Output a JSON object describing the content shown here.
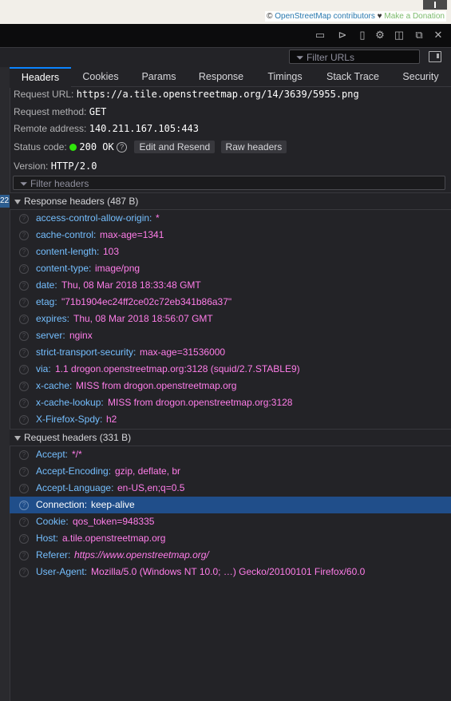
{
  "map": {
    "attribution_prefix": "©",
    "osm_link": "OpenStreetMap contributors",
    "heart": "♥",
    "donate": "Make a Donation"
  },
  "toolbar": {
    "icons": [
      "dock-layout-icon",
      "console-icon",
      "responsive-icon",
      "settings-icon",
      "split-icon",
      "undock-icon",
      "close-icon"
    ]
  },
  "filter_urls": {
    "placeholder": "Filter URLs"
  },
  "gutter": {
    "mark": "22"
  },
  "tabs": [
    "Headers",
    "Cookies",
    "Params",
    "Response",
    "Timings",
    "Stack Trace",
    "Security"
  ],
  "active_tab": "Headers",
  "summary": {
    "request_url_label": "Request URL:",
    "request_url": "https://a.tile.openstreetmap.org/14/3639/5955.png",
    "method_label": "Request method:",
    "method": "GET",
    "remote_label": "Remote address:",
    "remote": "140.211.167.105:443",
    "status_label": "Status code:",
    "status": "200 OK",
    "status_color": "#30e60b",
    "edit_resend": "Edit and Resend",
    "raw_headers": "Raw headers",
    "version_label": "Version:",
    "version": "HTTP/2.0"
  },
  "filter_headers": {
    "placeholder": "Filter headers"
  },
  "response_headers": {
    "title": "Response headers (487 B)",
    "rows": [
      {
        "k": "access-control-allow-origin:",
        "v": "*"
      },
      {
        "k": "cache-control:",
        "v": "max-age=1341"
      },
      {
        "k": "content-length:",
        "v": "103"
      },
      {
        "k": "content-type:",
        "v": "image/png"
      },
      {
        "k": "date:",
        "v": "Thu, 08 Mar 2018 18:33:48 GMT"
      },
      {
        "k": "etag:",
        "v": "\"71b1904ec24ff2ce02c72eb341b86a37\""
      },
      {
        "k": "expires:",
        "v": "Thu, 08 Mar 2018 18:56:07 GMT"
      },
      {
        "k": "server:",
        "v": "nginx"
      },
      {
        "k": "strict-transport-security:",
        "v": "max-age=31536000"
      },
      {
        "k": "via:",
        "v": "1.1 drogon.openstreetmap.org:3128 (squid/2.7.STABLE9)"
      },
      {
        "k": "x-cache:",
        "v": "MISS from drogon.openstreetmap.org"
      },
      {
        "k": "x-cache-lookup:",
        "v": "MISS from drogon.openstreetmap.org:3128"
      },
      {
        "k": "X-Firefox-Spdy:",
        "v": "h2"
      }
    ]
  },
  "request_headers": {
    "title": "Request headers (331 B)",
    "rows": [
      {
        "k": "Accept:",
        "v": "*/*"
      },
      {
        "k": "Accept-Encoding:",
        "v": "gzip, deflate, br"
      },
      {
        "k": "Accept-Language:",
        "v": "en-US,en;q=0.5"
      },
      {
        "k": "Connection:",
        "v": "keep-alive"
      },
      {
        "k": "Cookie:",
        "v": "qos_token=948335"
      },
      {
        "k": "Host:",
        "v": "a.tile.openstreetmap.org"
      },
      {
        "k": "Referer:",
        "v": "https://www.openstreetmap.org/"
      },
      {
        "k": "User-Agent:",
        "v": "Mozilla/5.0 (Windows NT 10.0; …) Gecko/20100101 Firefox/60.0"
      }
    ],
    "selected": "Connection:"
  },
  "colors": {
    "accent": "#0a84ff",
    "header_name": "#75bfff",
    "header_value": "#ff7de9",
    "selected_row": "#204e8a"
  }
}
